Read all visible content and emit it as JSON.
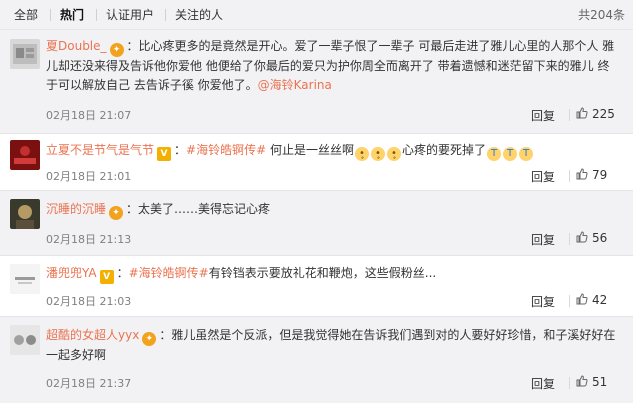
{
  "tabs": {
    "all": "全部",
    "hot": "热门",
    "verified": "认证用户",
    "following": "关注的人",
    "total": "共204条"
  },
  "comments": [
    {
      "user": "夏Double_",
      "text": "比心疼更多的是竟然是开心。爱了一辈子恨了一辈子 可最后走进了雅儿心里的人那个人 雅儿却还没来得及告诉他你爱他 他便给了你最后的爱只为护你周全而离开了 带着遗憾和迷茫留下来的雅儿 终于可以解放自己 去告诉子徯 你爱他了。",
      "mention": "@海铃Karina",
      "time": "02月18日 21:07",
      "reply": "回复",
      "likes": "225"
    },
    {
      "user": "立夏不是节气是气节",
      "topic": "#海铃皓锕传#",
      "text": "何止是一丝丝啊",
      "text2": "心疼的要死掉了",
      "time": "02月18日 21:01",
      "reply": "回复",
      "likes": "79"
    },
    {
      "user": "沉睡的沉睡",
      "text": "太美了……美得忘记心疼",
      "time": "02月18日 21:13",
      "reply": "回复",
      "likes": "56"
    },
    {
      "user": "潘兜兜YA",
      "topic": "#海铃皓锕传#",
      "text": "有铃铛表示要放礼花和鞭炮，这些假粉丝...",
      "time": "02月18日 21:03",
      "reply": "回复",
      "likes": "42"
    },
    {
      "user": "超酷的女超人yyx",
      "text": "雅儿虽然是个反派，但是我觉得她在告诉我们遇到对的人要好好珍惜，和子溪好好在一起多好啊",
      "time": "02月18日 21:37",
      "reply": "回复",
      "likes": "51"
    }
  ],
  "colors": {
    "username": "#eb7350",
    "background_alt": "#f2f2f5"
  },
  "icons": {
    "like": "thumb-up-icon",
    "badge": "vip-badge-icon"
  }
}
